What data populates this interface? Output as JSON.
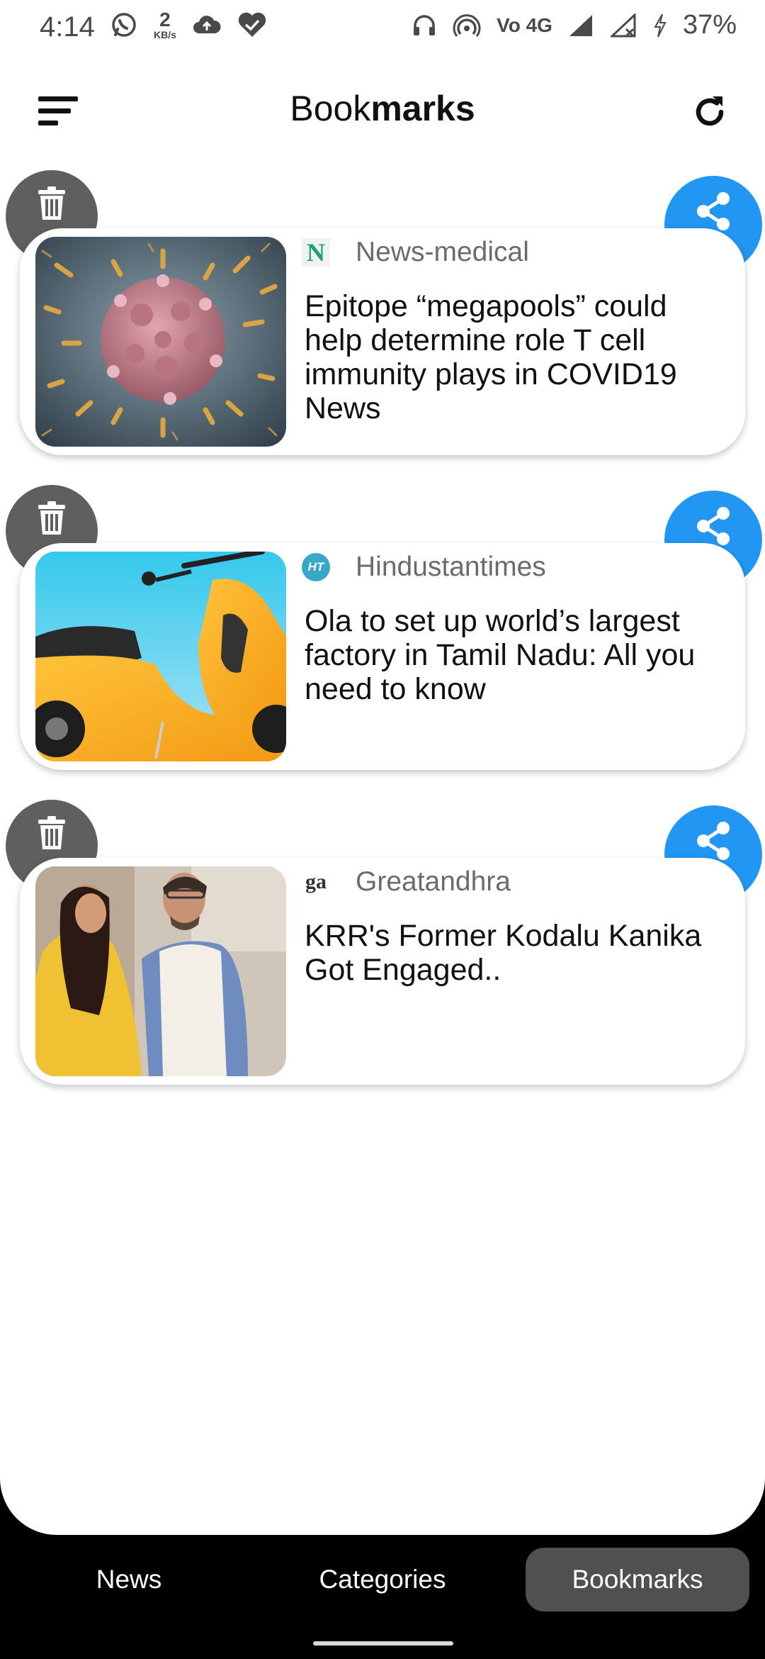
{
  "status_bar": {
    "time": "4:14",
    "speed_value": "2",
    "speed_unit": "KB/s",
    "network": "Vo 4G",
    "battery": "37%"
  },
  "header": {
    "title_regular": "Book",
    "title_bold": "marks"
  },
  "bookmarks": [
    {
      "source": "News-medical",
      "source_logo": "N",
      "headline": "Epitope “megapools” could help determine role T cell immunity plays in COVID19 News"
    },
    {
      "source": "Hindustantimes",
      "source_logo": "HT",
      "headline": "Ola to set up world’s largest factory in Tamil Nadu: All you need to know"
    },
    {
      "source": "Greatandhra",
      "source_logo": "ga",
      "headline": "KRR's Former Kodalu Kanika Got Engaged.."
    }
  ],
  "bottom_nav": {
    "news": "News",
    "categories": "Categories",
    "bookmarks": "Bookmarks",
    "active": "Bookmarks"
  },
  "colors": {
    "share": "#2196f3",
    "delete": "#5f5f5f",
    "nav_active": "#505050"
  }
}
